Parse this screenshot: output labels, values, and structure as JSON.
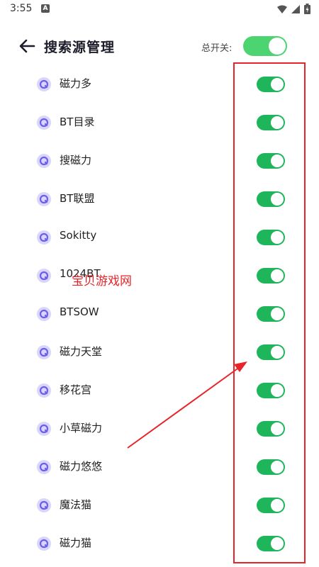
{
  "status_bar": {
    "time": "3:55",
    "notification_letter": "A"
  },
  "header": {
    "title": "搜索源管理",
    "master_switch_label": "总开关:",
    "master_switch_on": true
  },
  "sources": [
    {
      "name": "磁力多",
      "enabled": true
    },
    {
      "name": "BT目录",
      "enabled": true
    },
    {
      "name": "搜磁力",
      "enabled": true
    },
    {
      "name": "BT联盟",
      "enabled": true
    },
    {
      "name": "Sokitty",
      "enabled": true
    },
    {
      "name": "1024BT",
      "enabled": true
    },
    {
      "name": "BTSOW",
      "enabled": true
    },
    {
      "name": "磁力天堂",
      "enabled": true
    },
    {
      "name": "移花宫",
      "enabled": true
    },
    {
      "name": "小草磁力",
      "enabled": true
    },
    {
      "name": "磁力悠悠",
      "enabled": true
    },
    {
      "name": "魔法猫",
      "enabled": true
    },
    {
      "name": "磁力猫",
      "enabled": true
    }
  ],
  "overlay": {
    "watermark": "宝贝游戏网"
  },
  "colors": {
    "toggle_on": "#1fb55b",
    "master_toggle": "#4cd471",
    "icon_bg": "#d9d6fb",
    "annotation": "#e8242a"
  }
}
